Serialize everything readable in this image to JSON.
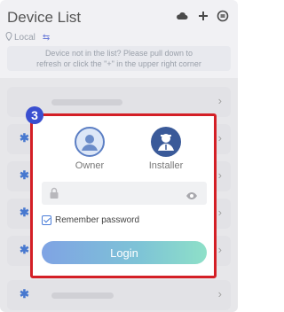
{
  "header": {
    "title": "Device List",
    "location": "Local",
    "icons": [
      "cloud-icon",
      "plus-icon",
      "settings-icon"
    ]
  },
  "notice": {
    "line1": "Device not in the list? Please pull down to",
    "line2": "refresh or click the \"+\" in the upper right corner"
  },
  "step_badge": "3",
  "login_dialog": {
    "roles": [
      {
        "label": "Owner",
        "icon": "owner-icon",
        "selected": false
      },
      {
        "label": "Installer",
        "icon": "installer-icon",
        "selected": true
      }
    ],
    "password_value": "",
    "remember_label": "Remember password",
    "remember_checked": true,
    "login_label": "Login"
  },
  "device_rows": [
    {
      "icon": "bluetooth-icon"
    },
    {
      "icon": "bluetooth-icon"
    },
    {
      "icon": "bluetooth-icon"
    },
    {
      "icon": "bluetooth-icon"
    },
    {
      "icon": "bluetooth-icon"
    },
    {
      "icon": "bluetooth-icon"
    }
  ],
  "colors": {
    "badge": "#3a4fd0",
    "highlight_border": "#d41f26",
    "login_gradient_start": "#7fa3e4",
    "login_gradient_end": "#8ee0c8",
    "bluetooth": "#4a7dd8"
  }
}
